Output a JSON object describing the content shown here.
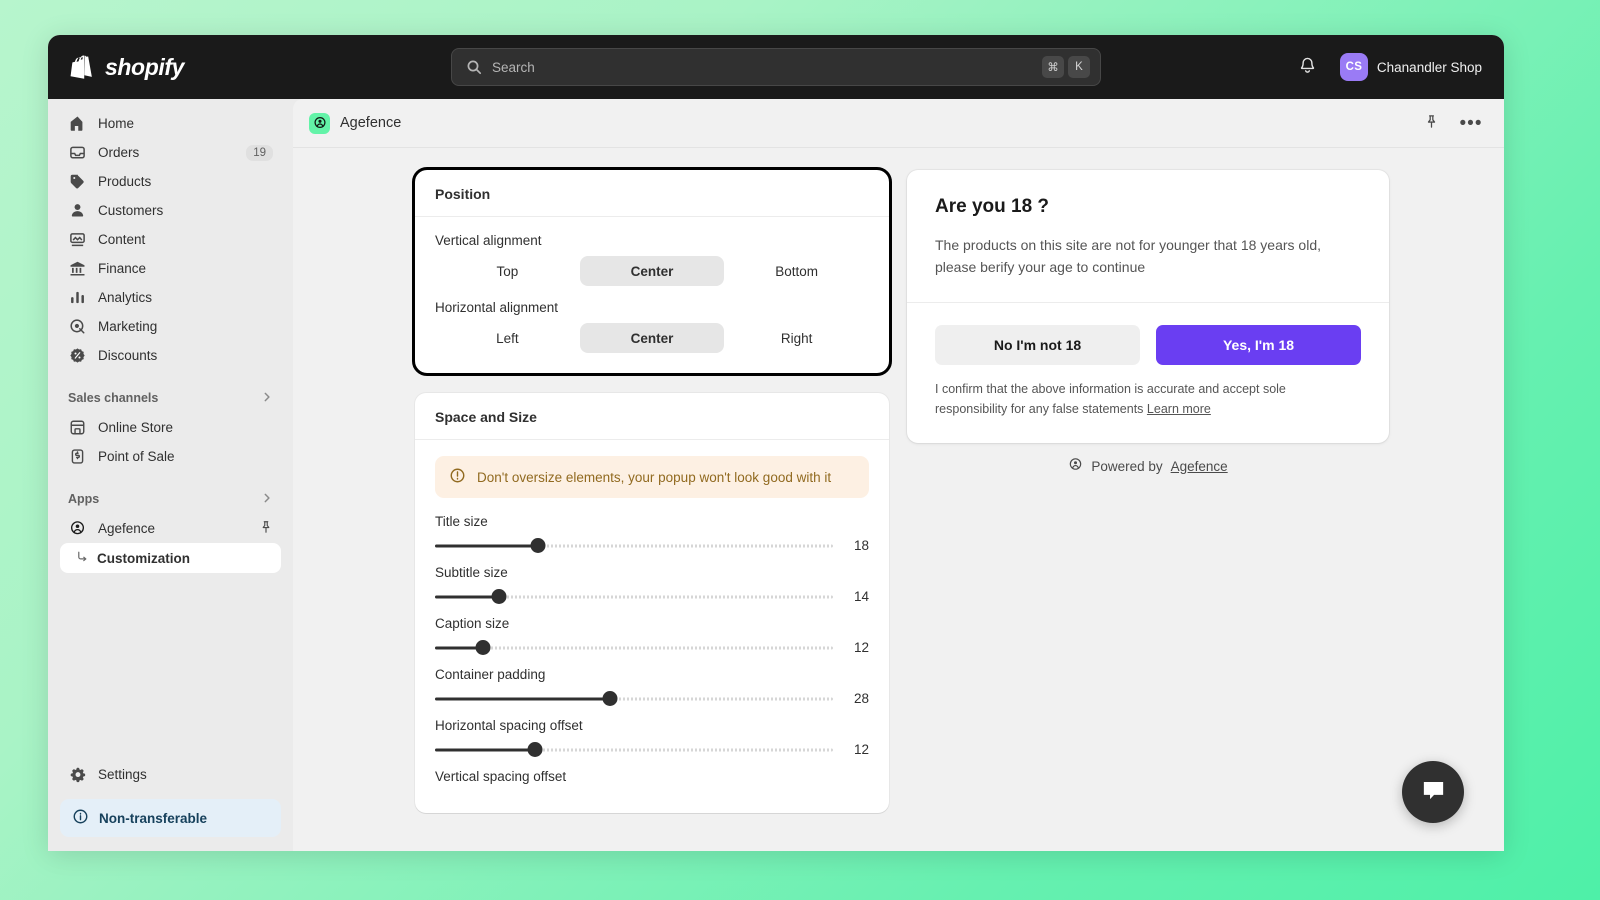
{
  "topbar": {
    "brand": "shopify",
    "search": {
      "placeholder": "Search",
      "value": "",
      "kbd_mod": "⌘",
      "kbd_key": "K"
    },
    "notifications_icon": "bell-icon",
    "user": {
      "initials": "CS",
      "name": "Chanandler Shop"
    }
  },
  "sidebar": {
    "items": [
      {
        "label": "Home",
        "icon": "home-icon",
        "badge": ""
      },
      {
        "label": "Orders",
        "icon": "orders-icon",
        "badge": "19"
      },
      {
        "label": "Products",
        "icon": "products-icon",
        "badge": ""
      },
      {
        "label": "Customers",
        "icon": "customers-icon",
        "badge": ""
      },
      {
        "label": "Content",
        "icon": "content-icon",
        "badge": ""
      },
      {
        "label": "Finance",
        "icon": "finance-icon",
        "badge": ""
      },
      {
        "label": "Analytics",
        "icon": "analytics-icon",
        "badge": ""
      },
      {
        "label": "Marketing",
        "icon": "marketing-icon",
        "badge": ""
      },
      {
        "label": "Discounts",
        "icon": "discounts-icon",
        "badge": ""
      }
    ],
    "sales_channels": {
      "label": "Sales channels",
      "items": [
        {
          "label": "Online Store",
          "icon": "store-icon"
        },
        {
          "label": "Point of Sale",
          "icon": "pos-icon"
        }
      ]
    },
    "apps": {
      "label": "Apps",
      "items": [
        {
          "label": "Agefence",
          "icon": "agefence-icon",
          "pin": "pin-icon"
        }
      ],
      "sub_item": {
        "label": "Customization"
      }
    },
    "settings": {
      "label": "Settings",
      "icon": "gear-icon"
    },
    "notice": {
      "label": "Non-transferable",
      "icon": "info-icon"
    }
  },
  "page": {
    "title": "Agefence",
    "app_icon": "agefence-badge-icon",
    "accent_green": "#63f3a8",
    "pin_icon": "pin-icon",
    "more_icon": "more-horizontal-icon"
  },
  "position_card": {
    "title": "Position",
    "vertical": {
      "label": "Vertical alignment",
      "options": [
        "Top",
        "Center",
        "Bottom"
      ],
      "selected": "Center"
    },
    "horizontal": {
      "label": "Horizontal alignment",
      "options": [
        "Left",
        "Center",
        "Right"
      ],
      "selected": "Center"
    }
  },
  "space_card": {
    "title": "Space and Size",
    "banner": {
      "icon": "warning-circle-icon",
      "text": "Don't oversize elements, your popup won't look good with it",
      "bg": "#fdf0e3",
      "fg": "#916a20"
    },
    "sliders": [
      {
        "label": "Title size",
        "value": "18",
        "percent": 26
      },
      {
        "label": "Subtitle size",
        "value": "14",
        "percent": 16
      },
      {
        "label": "Caption size",
        "value": "12",
        "percent": 12
      },
      {
        "label": "Container padding",
        "value": "28",
        "percent": 44
      },
      {
        "label": "Horizontal spacing offset",
        "value": "12",
        "percent": 25
      }
    ],
    "next_label": "Vertical spacing offset"
  },
  "preview": {
    "title": "Are you 18 ?",
    "subtitle": "The products on this site are not for younger that 18 years old, please berify your age to continue",
    "decline_label": "No I'm not 18",
    "accept_label": "Yes, I'm 18",
    "accept_color": "#6a3ef2",
    "caption": "I confirm that the above information is accurate and accept sole responsibility for any false statements",
    "caption_link": "Learn more",
    "powered_prefix": "Powered by",
    "powered_brand": "Agefence",
    "powered_icon": "agefence-icon"
  },
  "chat": {
    "icon": "chat-bubble-icon"
  }
}
